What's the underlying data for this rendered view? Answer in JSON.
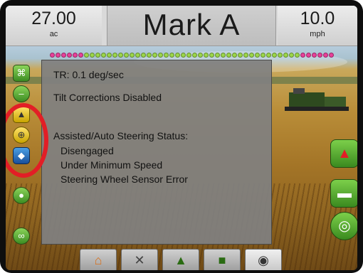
{
  "status_bar": {
    "area_value": "27.00",
    "area_unit": "ac",
    "title": "Mark A",
    "speed_value": "10.0",
    "speed_unit": "mph"
  },
  "info_panel": {
    "turn_rate": "TR: 0.1 deg/sec",
    "tilt_status": "Tilt Corrections Disabled",
    "steering_heading": "Assisted/Auto Steering Status:",
    "steering_states": [
      "Disengaged",
      "Under Minimum Speed",
      "Steering Wheel Sensor Error"
    ]
  },
  "boom_sections": {
    "colors": [
      "#e8409a",
      "#e8409a",
      "#e8409a",
      "#e8409a",
      "#e8409a",
      "#e8409a",
      "#9bd64a",
      "#9bd64a",
      "#9bd64a",
      "#9bd64a",
      "#9bd64a",
      "#9bd64a",
      "#9bd64a",
      "#9bd64a",
      "#9bd64a",
      "#9bd64a",
      "#9bd64a",
      "#9bd64a",
      "#9bd64a",
      "#9bd64a",
      "#9bd64a",
      "#9bd64a",
      "#9bd64a",
      "#9bd64a",
      "#9bd64a",
      "#9bd64a",
      "#9bd64a",
      "#9bd64a",
      "#9bd64a",
      "#9bd64a",
      "#9bd64a",
      "#9bd64a",
      "#9bd64a",
      "#9bd64a",
      "#9bd64a",
      "#9bd64a",
      "#9bd64a",
      "#9bd64a",
      "#9bd64a",
      "#9bd64a",
      "#9bd64a",
      "#9bd64a",
      "#9bd64a",
      "#9bd64a",
      "#e8409a",
      "#e8409a",
      "#e8409a",
      "#e8409a",
      "#e8409a",
      "#e8409a"
    ]
  },
  "left_toolbar": [
    "field-boundary-icon",
    "minus-icon",
    "guidance-icon",
    "steering-icon",
    "tilt-icon",
    "water-drop-icon",
    "link-icon"
  ],
  "right_toolbar": [
    "arrow-up-icon",
    "message-icon",
    "target-icon"
  ],
  "bottom_tabs": [
    "home-icon",
    "tools-icon",
    "vehicle-view-icon",
    "field-view-icon",
    "camera-icon"
  ],
  "colors": {
    "highlight_circle": "#e21e26",
    "button_green": "#3a8a1f",
    "panel_gray": "#808080"
  }
}
